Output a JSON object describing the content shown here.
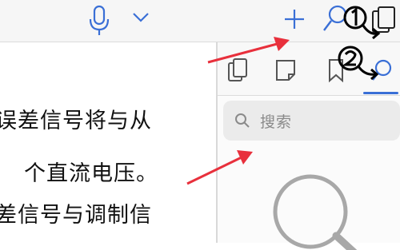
{
  "toolbar": {
    "icons": [
      "microphone-icon",
      "chevron-down-icon",
      "plus-icon",
      "search-icon",
      "cards-icon"
    ],
    "accent": "#3a6fd6"
  },
  "document": {
    "lines": [
      "误差信号将与从",
      "个直流电压。",
      "差信号与调制信"
    ]
  },
  "sidebar": {
    "tabs": [
      "pages-icon",
      "note-icon",
      "bookmark-icon",
      "search-icon"
    ],
    "search": {
      "placeholder": "搜索"
    }
  },
  "annotations": {
    "color": "#e8303c",
    "handwritten": [
      "①",
      "②"
    ]
  }
}
